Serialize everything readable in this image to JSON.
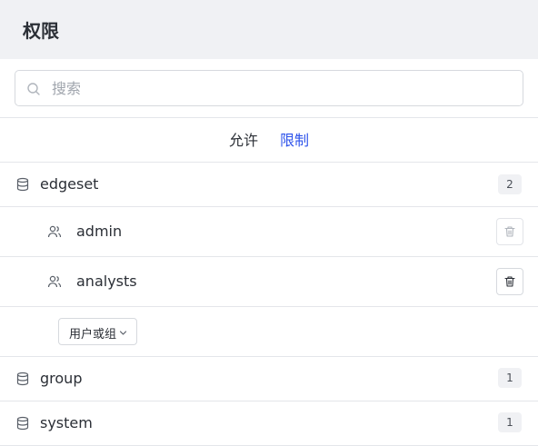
{
  "header": {
    "title": "权限"
  },
  "search": {
    "placeholder": "搜索",
    "value": ""
  },
  "tabs": [
    {
      "label": "允许",
      "active": true
    },
    {
      "label": "限制",
      "active": false
    }
  ],
  "colors": {
    "accent": "#2f54eb",
    "header_bg": "#f0f1f4",
    "divider": "#e4e6ea"
  },
  "databases": [
    {
      "name": "edgeset",
      "count": "2",
      "icon": "database-icon",
      "members": [
        {
          "name": "admin",
          "icon": "users-icon"
        },
        {
          "name": "analysts",
          "icon": "users-icon"
        }
      ],
      "add_select": {
        "label": "用户或组"
      }
    },
    {
      "name": "group",
      "count": "1",
      "icon": "database-icon"
    },
    {
      "name": "system",
      "count": "1",
      "icon": "database-icon"
    }
  ]
}
